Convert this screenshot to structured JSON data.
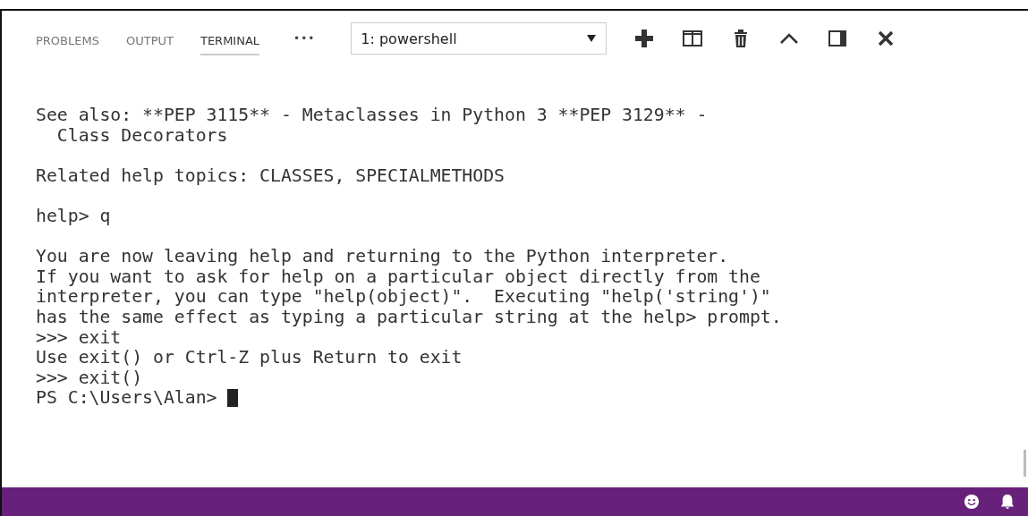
{
  "tabs": [
    {
      "label": "PROBLEMS",
      "selected": false
    },
    {
      "label": "OUTPUT",
      "selected": false
    },
    {
      "label": "TERMINAL",
      "selected": true
    }
  ],
  "more": "•••",
  "terminal_select": {
    "value": "1: powershell"
  },
  "terminal": {
    "lines": [
      {
        "kind": "text",
        "text": "See also: **PEP 3115** - Metaclasses in Python 3 **PEP 3129** -"
      },
      {
        "kind": "text",
        "text": "  Class Decorators"
      },
      {
        "kind": "blank"
      },
      {
        "kind": "text",
        "text": "Related help topics: CLASSES, SPECIALMETHODS"
      },
      {
        "kind": "blank"
      },
      {
        "kind": "text",
        "text": "help> q"
      },
      {
        "kind": "blank"
      },
      {
        "kind": "text",
        "text": "You are now leaving help and returning to the Python interpreter."
      },
      {
        "kind": "text",
        "text": "If you want to ask for help on a particular object directly from the"
      },
      {
        "kind": "text",
        "text": "interpreter, you can type \"help(object)\".  Executing \"help('string')\""
      },
      {
        "kind": "text",
        "text": "has the same effect as typing a particular string at the help> prompt."
      },
      {
        "kind": "text",
        "text": ">>> exit"
      },
      {
        "kind": "text",
        "text": "Use exit() or Ctrl-Z plus Return to exit"
      },
      {
        "kind": "text",
        "text": ">>> exit()"
      },
      {
        "kind": "prompt",
        "text": "PS C:\\Users\\Alan> "
      }
    ]
  }
}
